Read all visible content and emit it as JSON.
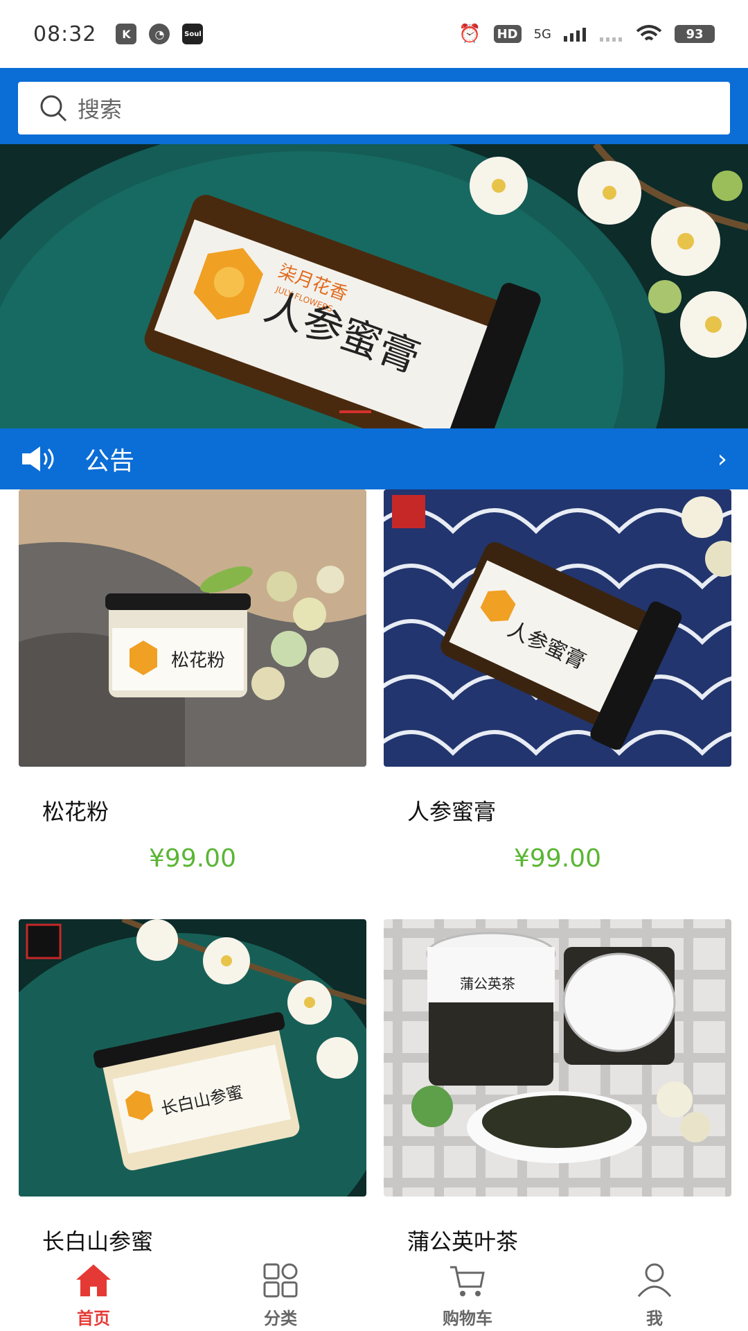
{
  "status_bar": {
    "time": "08:32",
    "app_icons": [
      "K",
      "",
      "Soul"
    ],
    "network": "5G",
    "hd": "HD",
    "battery": "93"
  },
  "search": {
    "placeholder": "搜索"
  },
  "notice": {
    "label": "公告"
  },
  "products": [
    {
      "name": "松花粉",
      "price": "¥99.00"
    },
    {
      "name": "人参蜜膏",
      "price": "¥99.00"
    },
    {
      "name": "长白山参蜜",
      "price": ""
    },
    {
      "name": "蒲公英叶茶",
      "price": ""
    }
  ],
  "product_image_text": {
    "banner_brand": "柒月花香",
    "banner_brand_en": "JULY FLOWERS",
    "banner_product": "人参蜜膏",
    "label_1": "松花粉",
    "label_2": "人参蜜膏",
    "label_3": "长白山参蜜",
    "label_4": "蒲公英茶"
  },
  "bottom_nav": [
    {
      "label": "首页",
      "icon": "home-icon",
      "active": true
    },
    {
      "label": "分类",
      "icon": "category-grid-icon",
      "active": false
    },
    {
      "label": "购物车",
      "icon": "shopping-cart-icon",
      "active": false
    },
    {
      "label": "我",
      "icon": "user-icon",
      "active": false
    }
  ],
  "colors": {
    "primary_blue": "#0b6dd6",
    "price_green": "#5ab634",
    "active_red": "#e53935"
  }
}
